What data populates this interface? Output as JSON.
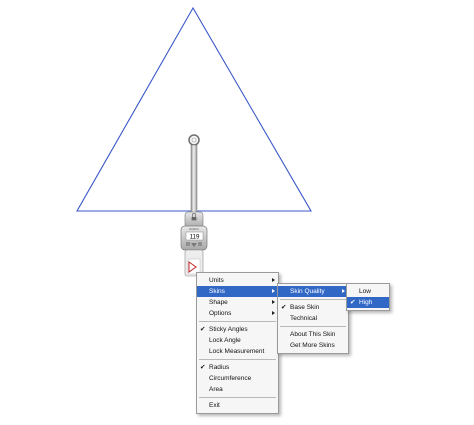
{
  "tool": {
    "readout": "119",
    "small_label": "RADIUS"
  },
  "context_menu": {
    "items": [
      {
        "label": "Units",
        "submenu": true
      },
      {
        "label": "Skins",
        "submenu": true,
        "highlighted": true
      },
      {
        "label": "Shape",
        "submenu": true
      },
      {
        "label": "Options",
        "submenu": true
      },
      {
        "separator": true
      },
      {
        "label": "Sticky Angles",
        "checked": true
      },
      {
        "label": "Lock Angle"
      },
      {
        "label": "Lock Measurement"
      },
      {
        "separator": true
      },
      {
        "label": "Radius",
        "checked": true
      },
      {
        "label": "Circumference"
      },
      {
        "label": "Area"
      },
      {
        "separator": true
      },
      {
        "label": "Exit"
      }
    ]
  },
  "skins_menu": {
    "items": [
      {
        "label": "Skin Quality",
        "submenu": true,
        "highlighted": true
      },
      {
        "separator": true
      },
      {
        "label": "Base Skin",
        "checked": true
      },
      {
        "label": "Technical"
      },
      {
        "separator": true
      },
      {
        "label": "About This Skin"
      },
      {
        "label": "Get More Skins"
      }
    ]
  },
  "quality_menu": {
    "items": [
      {
        "label": "Low"
      },
      {
        "label": "High",
        "checked": true,
        "highlighted": true
      }
    ]
  },
  "colors": {
    "triangle_stroke": "#3b58c8",
    "menu_highlight": "#3168c6",
    "tool_body": "#c9c9c9",
    "badge_red": "#c62828"
  },
  "glyphs": {
    "check": "✔"
  }
}
